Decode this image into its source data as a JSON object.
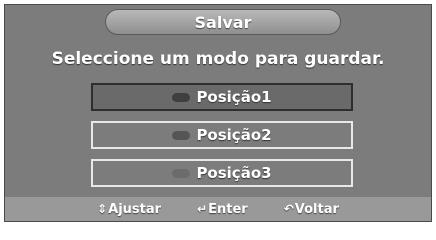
{
  "dialog": {
    "title": "Salvar",
    "prompt": "Seleccione um modo para guardar."
  },
  "slots": [
    {
      "label": "Posição1",
      "selected": true
    },
    {
      "label": "Posição2",
      "selected": false
    },
    {
      "label": "Posição3",
      "selected": false
    }
  ],
  "footer": {
    "adjust_label": "Ajustar",
    "enter_label": "Enter",
    "back_label": "Voltar",
    "adjust_icon": "up-down-arrows-icon",
    "enter_icon": "enter-icon",
    "back_icon": "return-arrow-icon"
  },
  "colors": {
    "panel": "#7c7c7c",
    "selected": "#6a6a6a",
    "text": "#ffffff"
  }
}
